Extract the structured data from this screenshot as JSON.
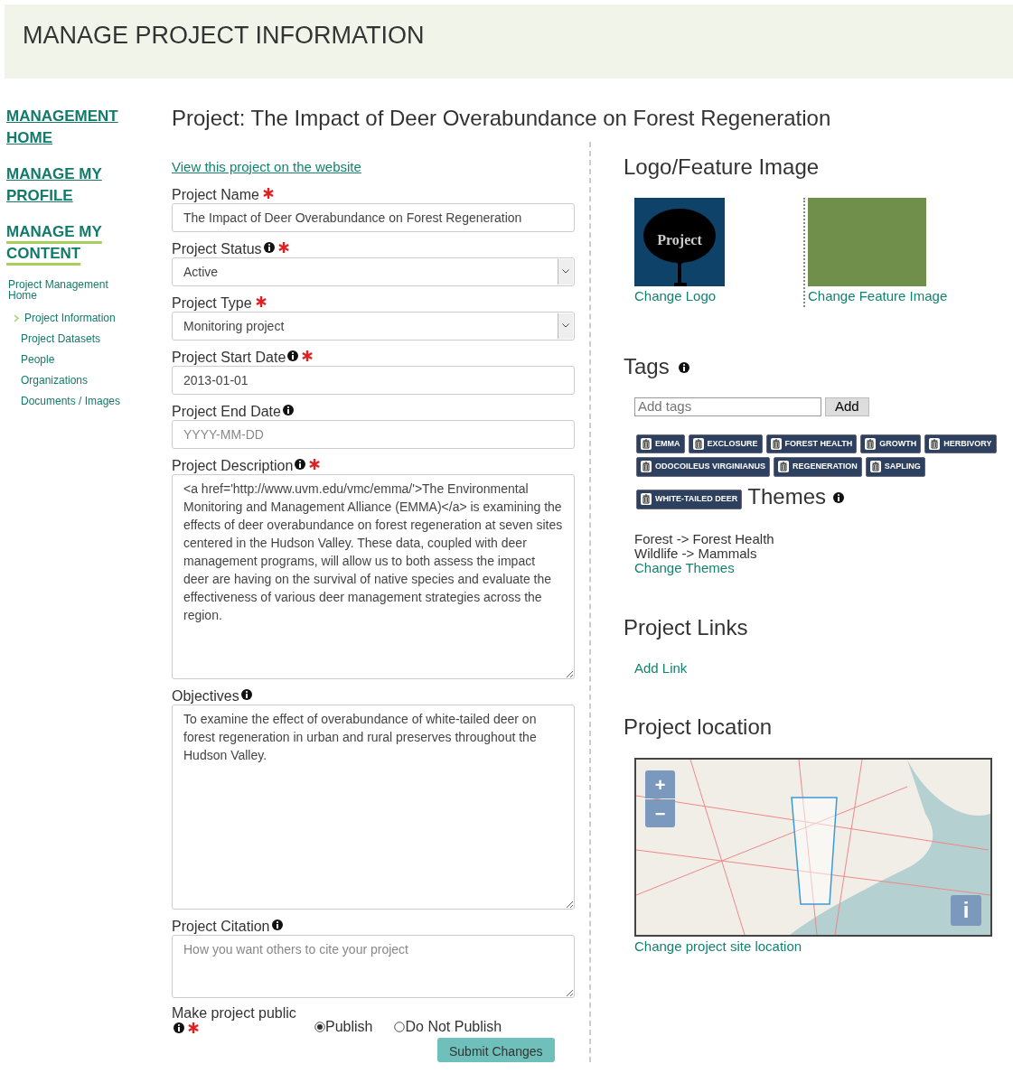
{
  "header": {
    "title": "MANAGE PROJECT INFORMATION"
  },
  "sidebar": {
    "sections": [
      {
        "label": "MANAGEMENT HOME",
        "selected": false
      },
      {
        "label": "MANAGE MY PROFILE",
        "selected": false
      },
      {
        "label": "MANAGE MY CONTENT",
        "selected": true
      }
    ],
    "items": [
      {
        "label": "Project Management Home",
        "selected": false,
        "children": [
          {
            "label": "Project Information",
            "selected": true
          },
          {
            "label": "Project Datasets",
            "selected": false
          },
          {
            "label": "People",
            "selected": false
          },
          {
            "label": "Organizations",
            "selected": false
          },
          {
            "label": "Documents / Images",
            "selected": false
          }
        ]
      }
    ]
  },
  "main": {
    "title": "Project: The Impact of Deer Overabundance on Forest Regeneration",
    "view_link": "View this project on the website",
    "fields": [
      {
        "kind": "text",
        "label": "Project Name",
        "info": false,
        "required": true,
        "value": "The Impact of Deer Overabundance on Forest Regeneration"
      },
      {
        "kind": "select",
        "label": "Project Status",
        "info": true,
        "required": true,
        "value": "Active"
      },
      {
        "kind": "select",
        "label": "Project Type",
        "info": false,
        "required": true,
        "value": "Monitoring project"
      },
      {
        "kind": "text",
        "label": "Project Start Date",
        "info": true,
        "required": true,
        "value": "2013-01-01"
      },
      {
        "kind": "text",
        "label": "Project End Date",
        "info": true,
        "required": false,
        "placeholder": "YYYY-MM-DD"
      },
      {
        "kind": "textarea",
        "label": "Project Description",
        "info": true,
        "required": true,
        "value": "<a href='http://www.uvm.edu/vmc/emma/'>The Environmental Monitoring and Management Alliance (EMMA)</a> is examining the effects of deer overabundance on forest regeneration at seven sites centered in the Hudson Valley. These data, coupled with deer management programs, will allow us to both assess the impact deer are having on the survival of native species and evaluate the effectiveness of various deer management strategies across the region."
      },
      {
        "kind": "textarea",
        "label": "Objectives",
        "info": true,
        "required": false,
        "value": "To examine the effect of overabundance of white-tailed deer on forest regeneration in urban and rural preserves throughout the Hudson Valley."
      },
      {
        "kind": "textarea-small",
        "label": "Project Citation",
        "info": true,
        "required": false,
        "placeholder": "How you want others to cite your project"
      }
    ],
    "publish": {
      "label": "Make project public",
      "info": true,
      "required": true,
      "options": [
        {
          "label": "Publish",
          "selected": true
        },
        {
          "label": "Do Not Publish",
          "selected": false
        }
      ]
    },
    "submit": "Submit Changes"
  },
  "images": {
    "heading": "Logo/Feature Image",
    "logo_text": "Project",
    "change_logo": "Change Logo",
    "change_feature": "Change Feature Image"
  },
  "tags": {
    "heading": "Tags",
    "info": true,
    "placeholder": "Add tags",
    "add": "Add",
    "items": [
      "EMMA",
      "EXCLOSURE",
      "FOREST HEALTH",
      "GROWTH",
      "HERBIVORY",
      "ODOCOILEUS VIRGINIANUS",
      "REGENERATION",
      "SAPLING",
      "WHITE-TAILED DEER"
    ]
  },
  "themes": {
    "heading": "Themes",
    "info": true,
    "lines": [
      "Forest -> Forest Health",
      "Wildlife -> Mammals"
    ],
    "change": "Change Themes"
  },
  "links": {
    "heading": "Project Links",
    "add": "Add Link"
  },
  "location": {
    "heading": "Project location",
    "zoom_in": "+",
    "zoom_out": "−",
    "info": "i",
    "change": "Change project site location"
  }
}
